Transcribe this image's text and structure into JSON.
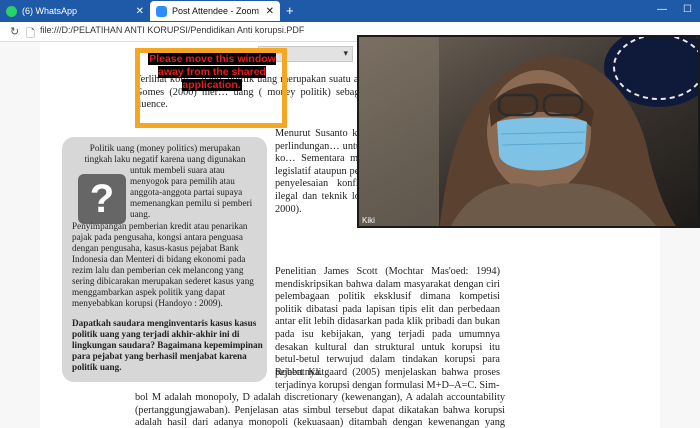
{
  "browser": {
    "tabs": [
      {
        "label": "(6) WhatsApp",
        "icon": "whatsapp-icon",
        "active": false
      },
      {
        "label": "Post Attendee - Zoom",
        "icon": "zoom-icon",
        "active": true
      }
    ],
    "new_tab": "+",
    "url": "file:///D:/PELATIHAN ANTI KORUPSI/Pendidikan Anti korupsi.PDF"
  },
  "zoom": {
    "warning": "Please move this window away from the shared application.",
    "participant_name": "Kiki"
  },
  "document": {
    "top_fragment": "Terlihat kom… uang, politik uang merupakan suatu aktivitas. Terkait dengan… Terrence Gomes (2000) mer… uang ( money politik) sebagai use of money and material to fluence.",
    "sidebar": {
      "heading": "Politik uang (money politics) merupakan tingkah laku negatif karena uang digunakan",
      "right_text": "untuk membeli suara atau menyogok para pemilih atau anggota-anggota partai supaya memenangkan pemilu si pemberi uang.",
      "full_text": "Penyimpangan pemberian kredit atau penarikan pajak pada pengusaha, kongsi antara penguasa dengan pengusaha, kasus-kasus pejabat Bank Indonesia dan Menteri di bidang ekonomi pada rezim lalu dan pemberian cek melancong yang sering dibicarakan merupakan sederet kasus yang menggambarkan aspek politik yang dapat menyebabkan korupsi (Handoyo : 2009).",
      "question": "Dapatkah saudara menginventaris kasus kasus politik uang yang terjadi akhir-akhir ini di lingkungan saudara? Bagaimana kepemimpinan para pejabat yang berhasil menjabat karena politik uang."
    },
    "col2_para1": "Menurut Susanto ko… lah dari sisi peneri… berian perlindungan… untuk kepentingan… disebabkan oleh ko… Sementara menurut… perilaku curang (pol… legislatif ataupun pe… untuk pembia-yaan kampanye, penyelesaian konflik parlemen melalui cara-cara ilegal dan teknik lobi yang menyimpang (De Asis : 2000).",
    "col2_para2": "Penelitian James Scott (Mochtar Mas'oed: 1994) mendiskripsikan bahwa dalam masyarakat dengan ciri pelembagaan politik eksklusif dimana kompetisi politik dibatasi pada lapisan tipis elit dan perbedaan antar elit lebih didasarkan pada klik pribadi dan bukan pada isu kebijakan, yang terjadi pada umumnya desakan kultural dan struktural untuk korupsi itu betul-betul terwujud dalam tindakan korupsi para pejabatnya.",
    "col2_para3": "Robert Klitgaard (2005) menjelaskan bahwa proses terjadinya korupsi dengan formulasi M+D–A=C. Sim-",
    "bottom_para": "bol M adalah monopoly, D adalah discretionary (kewenangan), A adalah accountability (pertanggungjawaban). Penjelasan atas simbul tersebut dapat dikatakan bahwa korupsi adalah hasil dari adanya monopoli (kekuasaan) ditambah dengan kewenangan yang begitu besar"
  }
}
